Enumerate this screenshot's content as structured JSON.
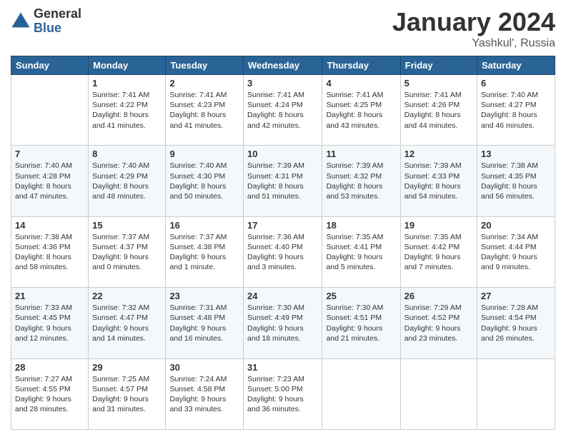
{
  "header": {
    "logo_general": "General",
    "logo_blue": "Blue",
    "month_title": "January 2024",
    "location": "Yashkul', Russia"
  },
  "days_of_week": [
    "Sunday",
    "Monday",
    "Tuesday",
    "Wednesday",
    "Thursday",
    "Friday",
    "Saturday"
  ],
  "weeks": [
    [
      {
        "num": "",
        "info": ""
      },
      {
        "num": "1",
        "info": "Sunrise: 7:41 AM\nSunset: 4:22 PM\nDaylight: 8 hours\nand 41 minutes."
      },
      {
        "num": "2",
        "info": "Sunrise: 7:41 AM\nSunset: 4:23 PM\nDaylight: 8 hours\nand 41 minutes."
      },
      {
        "num": "3",
        "info": "Sunrise: 7:41 AM\nSunset: 4:24 PM\nDaylight: 8 hours\nand 42 minutes."
      },
      {
        "num": "4",
        "info": "Sunrise: 7:41 AM\nSunset: 4:25 PM\nDaylight: 8 hours\nand 43 minutes."
      },
      {
        "num": "5",
        "info": "Sunrise: 7:41 AM\nSunset: 4:26 PM\nDaylight: 8 hours\nand 44 minutes."
      },
      {
        "num": "6",
        "info": "Sunrise: 7:40 AM\nSunset: 4:27 PM\nDaylight: 8 hours\nand 46 minutes."
      }
    ],
    [
      {
        "num": "7",
        "info": "Sunrise: 7:40 AM\nSunset: 4:28 PM\nDaylight: 8 hours\nand 47 minutes."
      },
      {
        "num": "8",
        "info": "Sunrise: 7:40 AM\nSunset: 4:29 PM\nDaylight: 8 hours\nand 48 minutes."
      },
      {
        "num": "9",
        "info": "Sunrise: 7:40 AM\nSunset: 4:30 PM\nDaylight: 8 hours\nand 50 minutes."
      },
      {
        "num": "10",
        "info": "Sunrise: 7:39 AM\nSunset: 4:31 PM\nDaylight: 8 hours\nand 51 minutes."
      },
      {
        "num": "11",
        "info": "Sunrise: 7:39 AM\nSunset: 4:32 PM\nDaylight: 8 hours\nand 53 minutes."
      },
      {
        "num": "12",
        "info": "Sunrise: 7:39 AM\nSunset: 4:33 PM\nDaylight: 8 hours\nand 54 minutes."
      },
      {
        "num": "13",
        "info": "Sunrise: 7:38 AM\nSunset: 4:35 PM\nDaylight: 8 hours\nand 56 minutes."
      }
    ],
    [
      {
        "num": "14",
        "info": "Sunrise: 7:38 AM\nSunset: 4:36 PM\nDaylight: 8 hours\nand 58 minutes."
      },
      {
        "num": "15",
        "info": "Sunrise: 7:37 AM\nSunset: 4:37 PM\nDaylight: 9 hours\nand 0 minutes."
      },
      {
        "num": "16",
        "info": "Sunrise: 7:37 AM\nSunset: 4:38 PM\nDaylight: 9 hours\nand 1 minute."
      },
      {
        "num": "17",
        "info": "Sunrise: 7:36 AM\nSunset: 4:40 PM\nDaylight: 9 hours\nand 3 minutes."
      },
      {
        "num": "18",
        "info": "Sunrise: 7:35 AM\nSunset: 4:41 PM\nDaylight: 9 hours\nand 5 minutes."
      },
      {
        "num": "19",
        "info": "Sunrise: 7:35 AM\nSunset: 4:42 PM\nDaylight: 9 hours\nand 7 minutes."
      },
      {
        "num": "20",
        "info": "Sunrise: 7:34 AM\nSunset: 4:44 PM\nDaylight: 9 hours\nand 9 minutes."
      }
    ],
    [
      {
        "num": "21",
        "info": "Sunrise: 7:33 AM\nSunset: 4:45 PM\nDaylight: 9 hours\nand 12 minutes."
      },
      {
        "num": "22",
        "info": "Sunrise: 7:32 AM\nSunset: 4:47 PM\nDaylight: 9 hours\nand 14 minutes."
      },
      {
        "num": "23",
        "info": "Sunrise: 7:31 AM\nSunset: 4:48 PM\nDaylight: 9 hours\nand 16 minutes."
      },
      {
        "num": "24",
        "info": "Sunrise: 7:30 AM\nSunset: 4:49 PM\nDaylight: 9 hours\nand 18 minutes."
      },
      {
        "num": "25",
        "info": "Sunrise: 7:30 AM\nSunset: 4:51 PM\nDaylight: 9 hours\nand 21 minutes."
      },
      {
        "num": "26",
        "info": "Sunrise: 7:29 AM\nSunset: 4:52 PM\nDaylight: 9 hours\nand 23 minutes."
      },
      {
        "num": "27",
        "info": "Sunrise: 7:28 AM\nSunset: 4:54 PM\nDaylight: 9 hours\nand 26 minutes."
      }
    ],
    [
      {
        "num": "28",
        "info": "Sunrise: 7:27 AM\nSunset: 4:55 PM\nDaylight: 9 hours\nand 28 minutes."
      },
      {
        "num": "29",
        "info": "Sunrise: 7:25 AM\nSunset: 4:57 PM\nDaylight: 9 hours\nand 31 minutes."
      },
      {
        "num": "30",
        "info": "Sunrise: 7:24 AM\nSunset: 4:58 PM\nDaylight: 9 hours\nand 33 minutes."
      },
      {
        "num": "31",
        "info": "Sunrise: 7:23 AM\nSunset: 5:00 PM\nDaylight: 9 hours\nand 36 minutes."
      },
      {
        "num": "",
        "info": ""
      },
      {
        "num": "",
        "info": ""
      },
      {
        "num": "",
        "info": ""
      }
    ]
  ]
}
